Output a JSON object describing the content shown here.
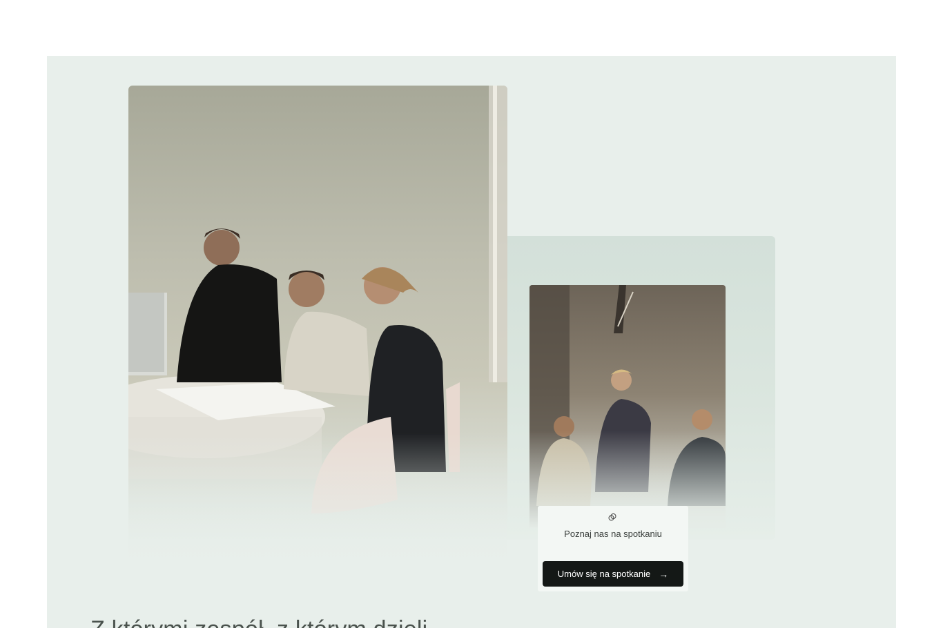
{
  "cta": {
    "icon": "chat-bubbles-icon",
    "text": "Poznaj nas na spotkaniu",
    "button_label": "Umów się na spotkanie",
    "button_icon": "arrow-right-icon"
  },
  "heading": {
    "partial_text": "Z którymi zespół, z którym dzieli..."
  },
  "colors": {
    "panel_bg": "#e8efeb",
    "button_bg": "#141816",
    "button_text": "#ffffff"
  }
}
